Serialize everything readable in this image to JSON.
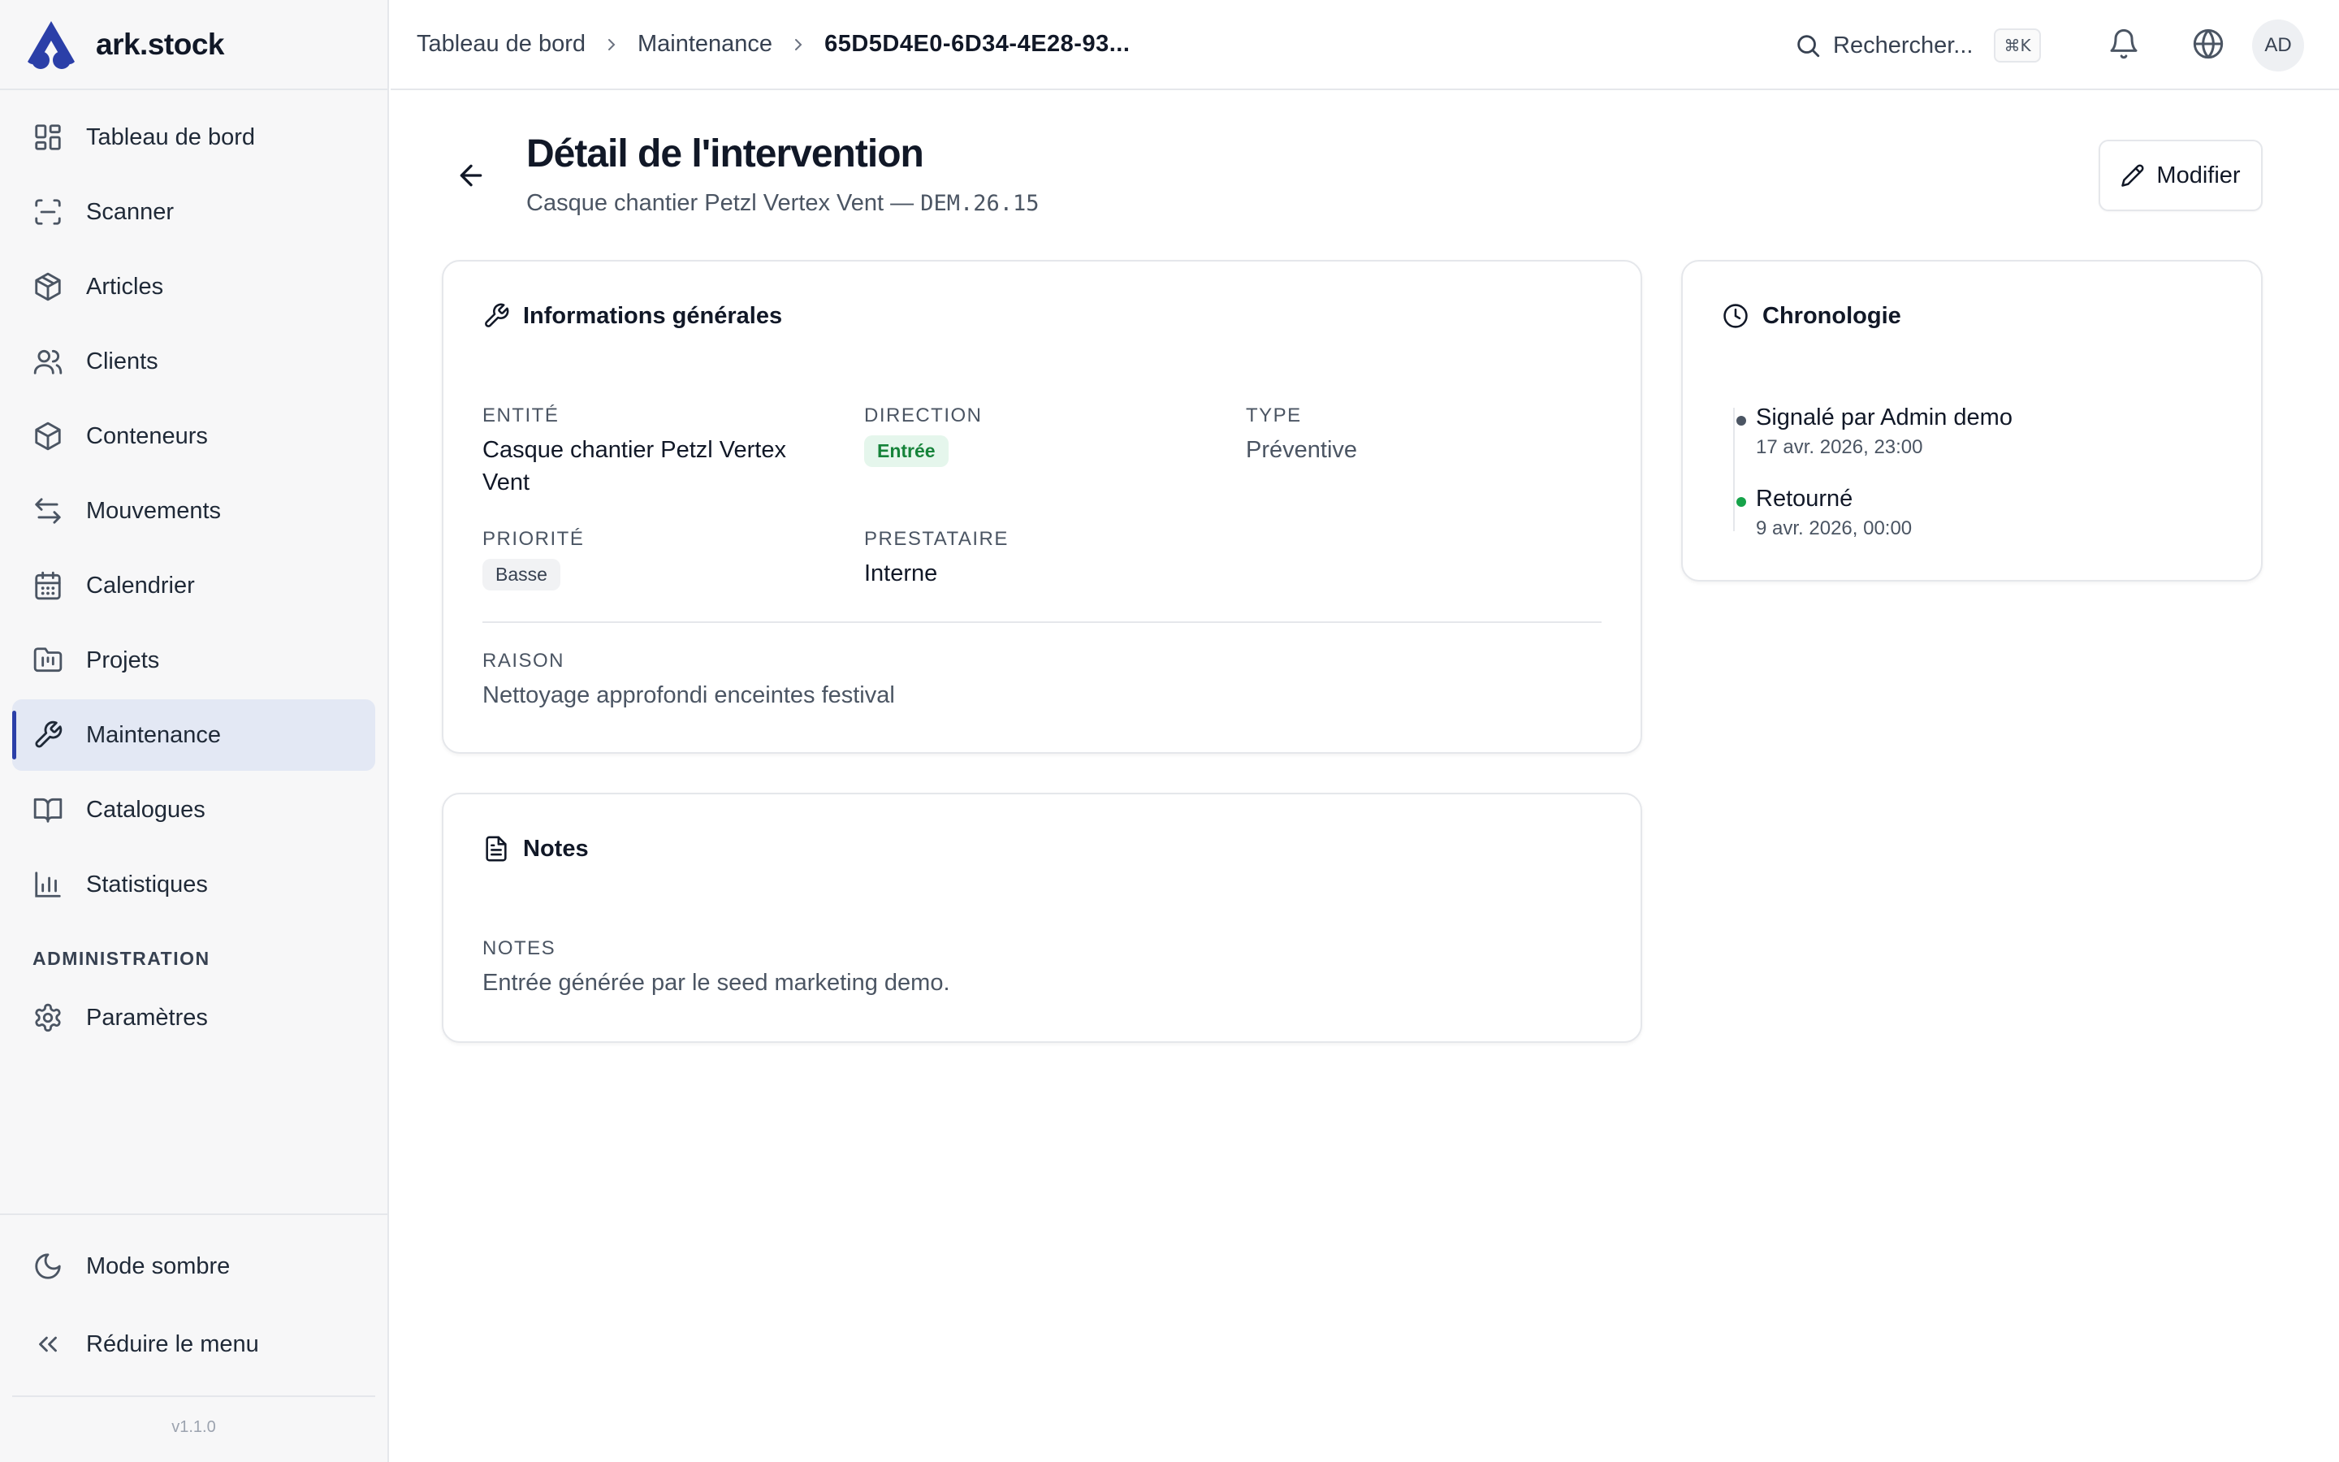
{
  "app": {
    "name": "ark.stock",
    "version": "v1.1.0"
  },
  "sidebar": {
    "items": [
      {
        "label": "Tableau de bord",
        "icon": "dashboard-icon"
      },
      {
        "label": "Scanner",
        "icon": "scan-icon"
      },
      {
        "label": "Articles",
        "icon": "box-icon"
      },
      {
        "label": "Clients",
        "icon": "users-icon"
      },
      {
        "label": "Conteneurs",
        "icon": "container-icon"
      },
      {
        "label": "Mouvements",
        "icon": "arrows-exchange-icon"
      },
      {
        "label": "Calendrier",
        "icon": "calendar-icon"
      },
      {
        "label": "Projets",
        "icon": "folder-kanban-icon"
      },
      {
        "label": "Maintenance",
        "icon": "wrench-icon",
        "active": true
      },
      {
        "label": "Catalogues",
        "icon": "book-open-icon"
      },
      {
        "label": "Statistiques",
        "icon": "bar-chart-icon"
      }
    ],
    "section_admin": "ADMINISTRATION",
    "admin_items": [
      {
        "label": "Paramètres",
        "icon": "gear-icon"
      }
    ],
    "bottom": {
      "dark_mode": "Mode sombre",
      "collapse": "Réduire le menu"
    }
  },
  "topbar": {
    "breadcrumb": [
      "Tableau de bord",
      "Maintenance",
      "65D5D4E0-6D34-4E28-93..."
    ],
    "search_label": "Rechercher...",
    "search_shortcut": "⌘K",
    "avatar_initials": "AD"
  },
  "page": {
    "title": "Détail de l'intervention",
    "subtitle_text": "Casque chantier Petzl Vertex Vent — ",
    "subtitle_code": "DEM.26.15",
    "edit_label": "Modifier"
  },
  "general": {
    "title": "Informations générales",
    "entity_label": "Entité",
    "entity_value": "Casque chantier Petzl Vertex Vent",
    "direction_label": "Direction",
    "direction_value": "Entrée",
    "type_label": "Type",
    "type_value": "Préventive",
    "priority_label": "Priorité",
    "priority_value": "Basse",
    "provider_label": "Prestataire",
    "provider_value": "Interne",
    "reason_label": "Raison",
    "reason_value": "Nettoyage approfondi enceintes festival"
  },
  "notes": {
    "title": "Notes",
    "label": "Notes",
    "value": "Entrée générée par le seed marketing demo."
  },
  "timeline": {
    "title": "Chronologie",
    "events": [
      {
        "title": "Signalé par Admin demo",
        "date": "17 avr. 2026, 23:00",
        "color": "#4b5563"
      },
      {
        "title": "Retourné",
        "date": "9 avr. 2026, 00:00",
        "color": "#16a34a"
      }
    ]
  },
  "colors": {
    "accent": "#2b3fa8",
    "active_bg": "#e3e8f4",
    "success": "#16833a",
    "success_bg": "#e5f6ec"
  }
}
